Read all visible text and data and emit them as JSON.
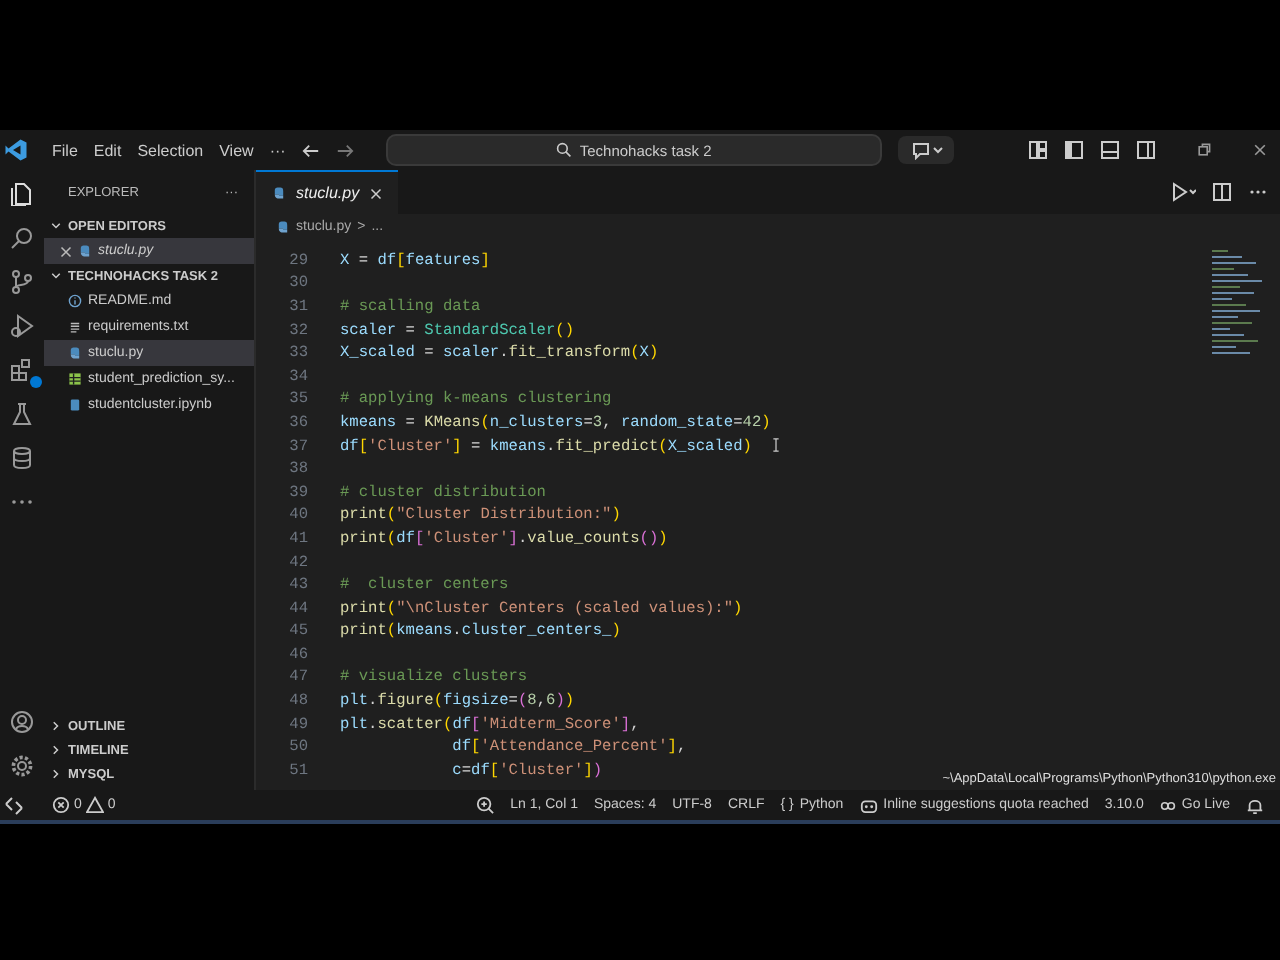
{
  "menu": [
    "File",
    "Edit",
    "Selection",
    "View",
    "···"
  ],
  "search": {
    "value": "Technohacks task 2"
  },
  "explorer": {
    "title": "EXPLORER",
    "more": "···",
    "open_editors": {
      "label": "OPEN EDITORS",
      "expanded": true,
      "files": [
        {
          "name": "stuclu.py",
          "kind": "python",
          "selected": true
        }
      ]
    },
    "folder": {
      "label": "TECHNOHACKS TASK 2",
      "expanded": true,
      "files": [
        {
          "name": "README.md",
          "kind": "info",
          "selected": false
        },
        {
          "name": "requirements.txt",
          "kind": "text",
          "selected": false
        },
        {
          "name": "stuclu.py",
          "kind": "python",
          "selected": true
        },
        {
          "name": "student_prediction_sy...",
          "kind": "sheet",
          "selected": false
        },
        {
          "name": "studentcluster.ipynb",
          "kind": "notebook",
          "selected": false
        }
      ]
    },
    "sections": [
      {
        "label": "OUTLINE",
        "expanded": false
      },
      {
        "label": "TIMELINE",
        "expanded": false
      },
      {
        "label": "MYSQL",
        "expanded": false
      }
    ]
  },
  "tabs": [
    {
      "label": "stuclu.py",
      "selected": true
    }
  ],
  "breadcrumb": [
    "stuclu.py",
    ">",
    "..."
  ],
  "code": [
    {
      "n": "29",
      "text": "X = df[features]"
    },
    {
      "n": "30"
    },
    {
      "n": "31",
      "text": "# scalling data"
    },
    {
      "n": "32",
      "text": "scaler = StandardScaler()"
    },
    {
      "n": "33",
      "text": "X_scaled = scaler.fit_transform(X)"
    },
    {
      "n": "34"
    },
    {
      "n": "35",
      "text": "# applying k-means clustering"
    },
    {
      "n": "36",
      "text": "kmeans = KMeans(n_clusters=3, random_state=42)"
    },
    {
      "n": "37",
      "text": "df['Cluster'] = kmeans.fit_predict(X_scaled)"
    },
    {
      "n": "38"
    },
    {
      "n": "39",
      "text": "# cluster distribution"
    },
    {
      "n": "40",
      "text": "print(\"Cluster Distribution:\")"
    },
    {
      "n": "41",
      "text": "print(df['Cluster'].value_counts())"
    },
    {
      "n": "42"
    },
    {
      "n": "43",
      "text": "#  cluster centers"
    },
    {
      "n": "44",
      "text": "print(\"\\nCluster Centers (scaled values):\")"
    },
    {
      "n": "45",
      "text": "print(kmeans.cluster_centers_)"
    },
    {
      "n": "46"
    },
    {
      "n": "47",
      "text": "# visualize clusters"
    },
    {
      "n": "48",
      "text": "plt.figure(figsize=(8,6))"
    },
    {
      "n": "49",
      "text": "plt.scatter(df['Midterm_Score'],"
    },
    {
      "n": "50",
      "text": "            df['Attendance_Percent'],"
    },
    {
      "n": "51",
      "text": "            c=df['Cluster'])"
    }
  ],
  "tooltip": "~\\AppData\\Local\\Programs\\Python\\Python310\\python.exe",
  "status": {
    "errors": "0",
    "warnings": "0",
    "language_icon": "{ }",
    "items": [
      "Ln 1, Col 1",
      "Spaces: 4",
      "UTF-8",
      "CRLF",
      "Python",
      "Inline suggestions quota reached",
      "3.10.0",
      "Go Live"
    ]
  }
}
